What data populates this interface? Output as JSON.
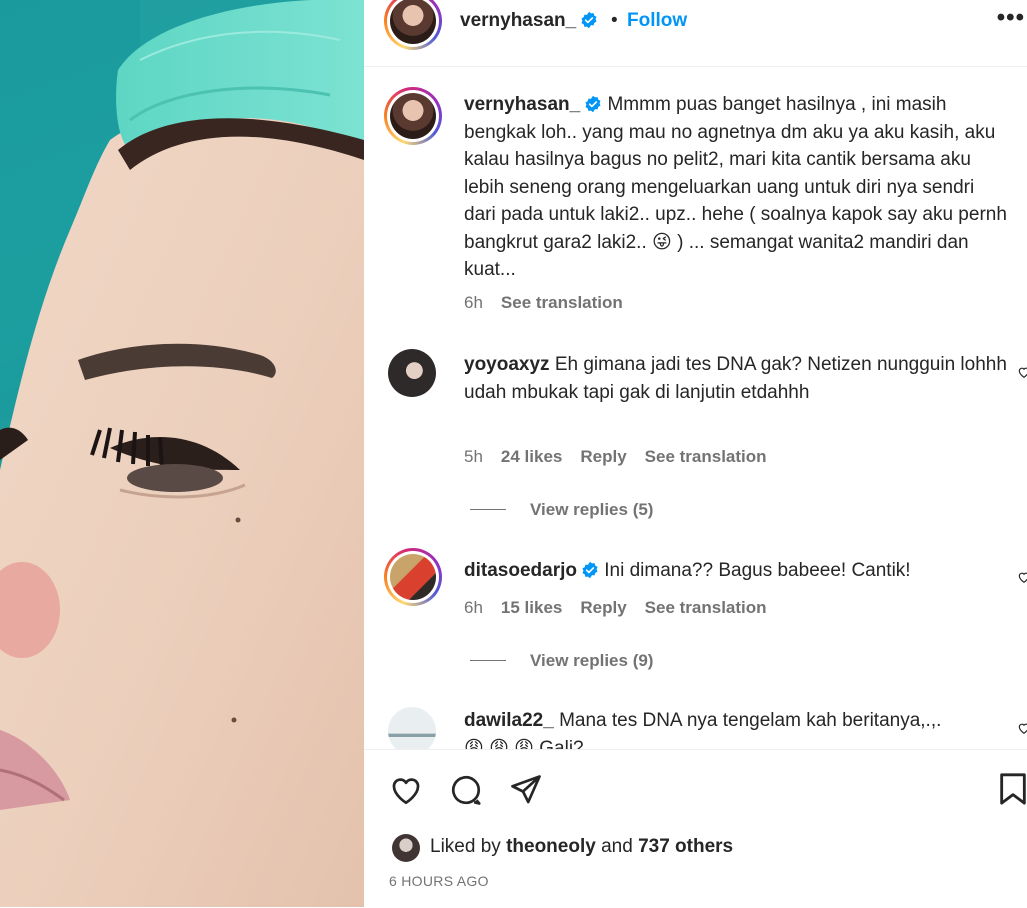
{
  "header": {
    "username": "vernyhasan_",
    "separator": "•",
    "follow_label": "Follow",
    "more_label": "•••"
  },
  "caption": {
    "username": "vernyhasan_",
    "text": "Mmmm puas banget hasilnya , ini masih bengkak loh.. yang mau no agnetnya dm aku ya aku kasih, aku kalau hasilnya bagus no pelit2, mari kita cantik bersama aku lebih seneng orang mengeluarkan uang untuk diri nya sendri dari pada untuk laki2.. upz.. hehe ( soalnya kapok say aku pernh bangkrut gara2 laki2.. 😜 ) ... semangat wanita2 mandiri dan kuat...",
    "time": "6h",
    "see_translation": "See translation"
  },
  "comments": [
    {
      "username": "yoyoaxyz",
      "text": "Eh gimana jadi tes DNA gak? Netizen nungguin lohhh udah mbukak tapi gak di lanjutin etdahhh",
      "time": "5h",
      "likes": "24 likes",
      "reply": "Reply",
      "see_translation": "See translation",
      "view_replies": "View replies (5)"
    },
    {
      "username": "ditasoedarjo",
      "text": "Ini dimana?? Bagus babeee! Cantik!",
      "time": "6h",
      "likes": "15 likes",
      "reply": "Reply",
      "see_translation": "See translation",
      "view_replies": "View replies (9)"
    },
    {
      "username": "dawila22_",
      "text": "Mana tes DNA nya tengelam kah beritanya,.,.",
      "partial_line": "😩 😩 😩  Gali?"
    }
  ],
  "footer": {
    "liked_prefix": "Liked by",
    "liked_user": "theoneoly",
    "liked_and": "and",
    "liked_others": "737 others",
    "time_ago": "6 HOURS AGO"
  },
  "colors": {
    "link_blue": "#0095f6",
    "verified_blue": "#0095f6",
    "secondary_text": "#737373",
    "primary_text": "#262626"
  }
}
